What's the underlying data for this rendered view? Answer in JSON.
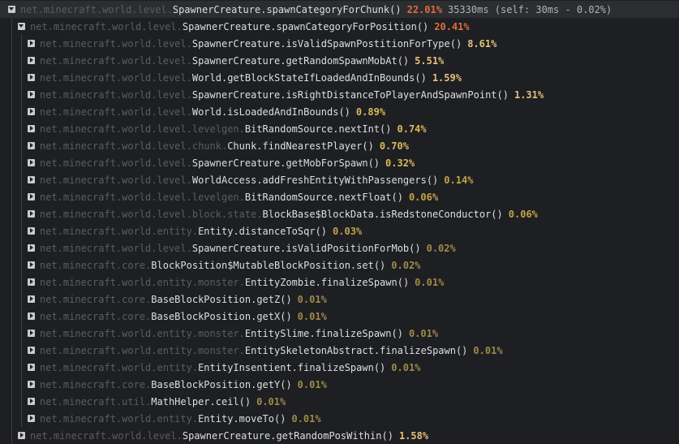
{
  "colors": {
    "background": "#1e1f22",
    "highlight_row": "#2b2d30",
    "package_text": "#5a5d63",
    "method_text": "#dcdfe4",
    "pct_hot": "#e06c3c",
    "pct_high": "#e5c07b",
    "pct_mid": "#d9b95a",
    "pct_low": "#c4a24a",
    "pct_dim": "#9e8a4a"
  },
  "rows": [
    {
      "depth": 0,
      "toggle": "open",
      "pkg": "net.minecraft.world.level.",
      "method": "SpawnerCreature.spawnCategoryForChunk()",
      "pct": "22.01%",
      "tier": "hot",
      "info": "35330ms (self: 30ms - 0.02%)",
      "highlight": true
    },
    {
      "depth": 1,
      "toggle": "open",
      "pkg": "net.minecraft.world.level.",
      "method": "SpawnerCreature.spawnCategoryForPosition()",
      "pct": "20.41%",
      "tier": "hot"
    },
    {
      "depth": 2,
      "toggle": "closed",
      "pkg": "net.minecraft.world.level.",
      "method": "SpawnerCreature.isValidSpawnPostitionForType()",
      "pct": "8.61%",
      "tier": "high"
    },
    {
      "depth": 2,
      "toggle": "closed",
      "pkg": "net.minecraft.world.level.",
      "method": "SpawnerCreature.getRandomSpawnMobAt()",
      "pct": "5.51%",
      "tier": "high"
    },
    {
      "depth": 2,
      "toggle": "closed",
      "pkg": "net.minecraft.world.level.",
      "method": "World.getBlockStateIfLoadedAndInBounds()",
      "pct": "1.59%",
      "tier": "high"
    },
    {
      "depth": 2,
      "toggle": "closed",
      "pkg": "net.minecraft.world.level.",
      "method": "SpawnerCreature.isRightDistanceToPlayerAndSpawnPoint()",
      "pct": "1.31%",
      "tier": "high"
    },
    {
      "depth": 2,
      "toggle": "closed",
      "pkg": "net.minecraft.world.level.",
      "method": "World.isLoadedAndInBounds()",
      "pct": "0.89%",
      "tier": "mid"
    },
    {
      "depth": 2,
      "toggle": "closed",
      "pkg": "net.minecraft.world.level.levelgen.",
      "method": "BitRandomSource.nextInt()",
      "pct": "0.74%",
      "tier": "mid"
    },
    {
      "depth": 2,
      "toggle": "closed",
      "pkg": "net.minecraft.world.level.chunk.",
      "method": "Chunk.findNearestPlayer()",
      "pct": "0.70%",
      "tier": "mid"
    },
    {
      "depth": 2,
      "toggle": "closed",
      "pkg": "net.minecraft.world.level.",
      "method": "SpawnerCreature.getMobForSpawn()",
      "pct": "0.32%",
      "tier": "mid"
    },
    {
      "depth": 2,
      "toggle": "closed",
      "pkg": "net.minecraft.world.level.",
      "method": "WorldAccess.addFreshEntityWithPassengers()",
      "pct": "0.14%",
      "tier": "low"
    },
    {
      "depth": 2,
      "toggle": "closed",
      "pkg": "net.minecraft.world.level.levelgen.",
      "method": "BitRandomSource.nextFloat()",
      "pct": "0.06%",
      "tier": "low"
    },
    {
      "depth": 2,
      "toggle": "closed",
      "pkg": "net.minecraft.world.level.block.state.",
      "method": "BlockBase$BlockData.isRedstoneConductor()",
      "pct": "0.06%",
      "tier": "low"
    },
    {
      "depth": 2,
      "toggle": "closed",
      "pkg": "net.minecraft.world.entity.",
      "method": "Entity.distanceToSqr()",
      "pct": "0.03%",
      "tier": "low"
    },
    {
      "depth": 2,
      "toggle": "closed",
      "pkg": "net.minecraft.world.level.",
      "method": "SpawnerCreature.isValidPositionForMob()",
      "pct": "0.02%",
      "tier": "dim"
    },
    {
      "depth": 2,
      "toggle": "closed",
      "pkg": "net.minecraft.core.",
      "method": "BlockPosition$MutableBlockPosition.set()",
      "pct": "0.02%",
      "tier": "dim"
    },
    {
      "depth": 2,
      "toggle": "closed",
      "pkg": "net.minecraft.world.entity.monster.",
      "method": "EntityZombie.finalizeSpawn()",
      "pct": "0.01%",
      "tier": "dim"
    },
    {
      "depth": 2,
      "toggle": "closed",
      "pkg": "net.minecraft.core.",
      "method": "BaseBlockPosition.getZ()",
      "pct": "0.01%",
      "tier": "dim"
    },
    {
      "depth": 2,
      "toggle": "closed",
      "pkg": "net.minecraft.core.",
      "method": "BaseBlockPosition.getX()",
      "pct": "0.01%",
      "tier": "dim"
    },
    {
      "depth": 2,
      "toggle": "closed",
      "pkg": "net.minecraft.world.entity.monster.",
      "method": "EntitySlime.finalizeSpawn()",
      "pct": "0.01%",
      "tier": "dim"
    },
    {
      "depth": 2,
      "toggle": "closed",
      "pkg": "net.minecraft.world.entity.monster.",
      "method": "EntitySkeletonAbstract.finalizeSpawn()",
      "pct": "0.01%",
      "tier": "dim"
    },
    {
      "depth": 2,
      "toggle": "closed",
      "pkg": "net.minecraft.world.entity.",
      "method": "EntityInsentient.finalizeSpawn()",
      "pct": "0.01%",
      "tier": "dim"
    },
    {
      "depth": 2,
      "toggle": "closed",
      "pkg": "net.minecraft.core.",
      "method": "BaseBlockPosition.getY()",
      "pct": "0.01%",
      "tier": "dim"
    },
    {
      "depth": 2,
      "toggle": "closed",
      "pkg": "net.minecraft.util.",
      "method": "MathHelper.ceil()",
      "pct": "0.01%",
      "tier": "dim"
    },
    {
      "depth": 2,
      "toggle": "closed",
      "pkg": "net.minecraft.world.entity.",
      "method": "Entity.moveTo()",
      "pct": "0.01%",
      "tier": "dim"
    },
    {
      "depth": 1,
      "toggle": "closed",
      "pkg": "net.minecraft.world.level.",
      "method": "SpawnerCreature.getRandomPosWithin()",
      "pct": "1.58%",
      "tier": "high"
    }
  ]
}
